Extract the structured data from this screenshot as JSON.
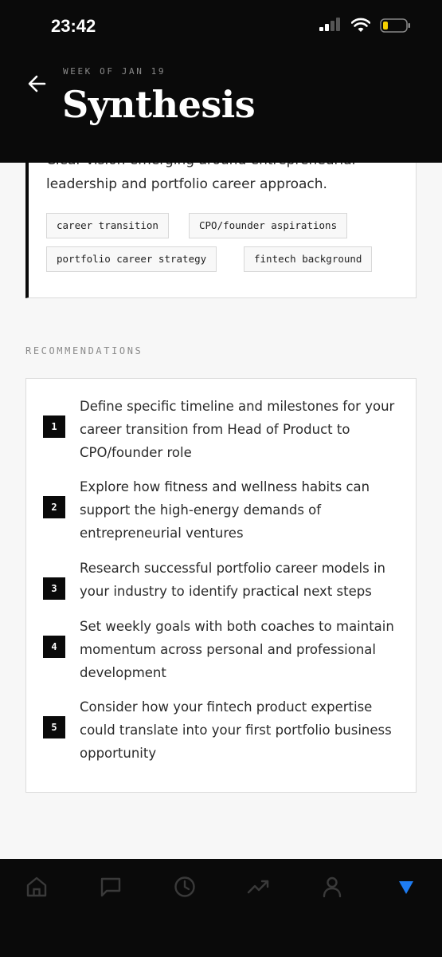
{
  "status_bar": {
    "time": "23:42"
  },
  "header": {
    "week_label": "WEEK OF JAN 19",
    "title": "Synthesis"
  },
  "insight": {
    "text": "Clear vision emerging around entrepreneurial leadership and portfolio career approach.",
    "tags": [
      "career transition",
      "CPO/founder aspirations",
      "portfolio career strategy",
      "fintech background"
    ]
  },
  "recommendations": {
    "label": "RECOMMENDATIONS",
    "items": [
      {
        "number": "1",
        "text": "Define specific timeline and milestones for your career transition from Head of Product to CPO/founder role"
      },
      {
        "number": "2",
        "text": "Explore how fitness and wellness habits can support the high-energy demands of entrepreneurial ventures"
      },
      {
        "number": "3",
        "text": "Research successful portfolio career models in your industry to identify practical next steps"
      },
      {
        "number": "4",
        "text": "Set weekly goals with both coaches to maintain momentum across personal and professional development"
      },
      {
        "number": "5",
        "text": "Consider how your fintech product expertise could translate into your first portfolio business opportunity"
      }
    ]
  },
  "bottom_nav": {
    "items": [
      "home-icon",
      "chat-icon",
      "clock-icon",
      "trending-up-icon",
      "profile-icon",
      "scroll-down-icon"
    ],
    "active_color": "#1e7cf2",
    "inactive_color": "#3a3a3a"
  }
}
